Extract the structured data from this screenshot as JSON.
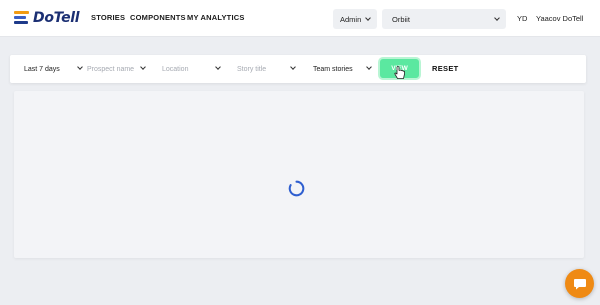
{
  "brand": {
    "name": "DoTell"
  },
  "nav": {
    "items": [
      "STORIES",
      "COMPONENTS",
      "MY ANALYTICS"
    ]
  },
  "header": {
    "role_select": {
      "value": "Admin"
    },
    "org_select": {
      "value": "Orbiit"
    },
    "user": {
      "initials": "YD",
      "name": "Yaacov DoTell"
    }
  },
  "filters": {
    "date_range": {
      "value": "Last 7 days"
    },
    "prospect": {
      "placeholder": "Prospect name"
    },
    "location": {
      "placeholder": "Location"
    },
    "story_title": {
      "placeholder": "Story title"
    },
    "story_scope": {
      "value": "Team stories"
    },
    "view_label": "VIEW",
    "reset_label": "RESET"
  },
  "colors": {
    "accent_green": "#5be8a0",
    "brand_navy": "#1b2f73",
    "chat_orange": "#ef8a14",
    "spinner_blue": "#2f5fd0"
  },
  "content": {
    "state": "loading"
  },
  "icons": {
    "logo": "dotell-logo-icon",
    "spinner": "loading-spinner-icon",
    "chat": "chat-bubble-icon",
    "cursor": "hand-cursor-icon"
  }
}
